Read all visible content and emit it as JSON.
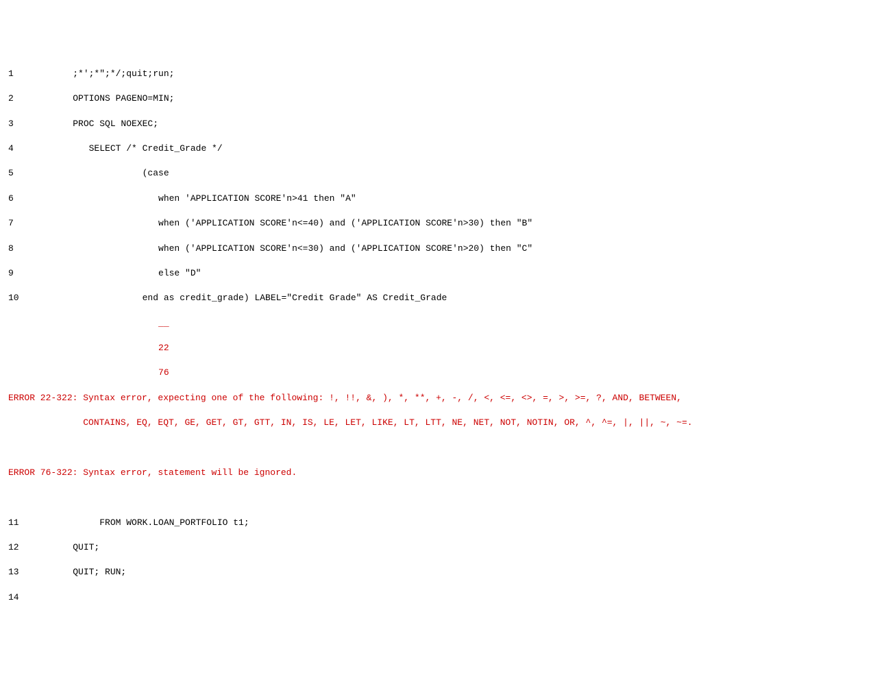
{
  "log": {
    "lines": [
      {
        "num": "1",
        "text": "         ;*';*\";*/;quit;run;"
      },
      {
        "num": "2",
        "text": "         OPTIONS PAGENO=MIN;"
      },
      {
        "num": "3",
        "text": "         PROC SQL NOEXEC;"
      },
      {
        "num": "4",
        "text": "            SELECT /* Credit_Grade */"
      },
      {
        "num": "5",
        "text": "                      (case"
      },
      {
        "num": "6",
        "text": "                         when 'APPLICATION SCORE'n>41 then \"A\""
      },
      {
        "num": "7",
        "text": "                         when ('APPLICATION SCORE'n<=40) and ('APPLICATION SCORE'n>30) then \"B\""
      },
      {
        "num": "8",
        "text": "                         when ('APPLICATION SCORE'n<=30) and ('APPLICATION SCORE'n>20) then \"C\""
      },
      {
        "num": "9",
        "text": "                         else \"D\""
      },
      {
        "num": "10",
        "text": "                      end as credit_grade) LABEL=\"Credit Grade\" AS Credit_Grade"
      }
    ],
    "marker_underline": "                         __",
    "marker_22": "                         22",
    "marker_76": "                         76",
    "error1_label": "ERROR 22-322: ",
    "error1_text1": "Syntax error, expecting one of the following: !, !!, &, ), *, **, +, -, /, <, <=, <>, =, >, >=, ?, AND, BETWEEN,",
    "error1_text2": "              CONTAINS, EQ, EQT, GE, GET, GT, GTT, IN, IS, LE, LET, LIKE, LT, LTT, NE, NET, NOT, NOTIN, OR, ^, ^=, |, ||, ~, ~=.",
    "error2_label": "ERROR 76-322: ",
    "error2_text": "Syntax error, statement will be ignored.",
    "lines2": [
      {
        "num": "11",
        "text": "              FROM WORK.LOAN_PORTFOLIO t1;"
      },
      {
        "num": "12",
        "text": "         QUIT;"
      },
      {
        "num": "13",
        "text": "         QUIT; RUN;"
      },
      {
        "num": "14",
        "text": ""
      }
    ]
  }
}
